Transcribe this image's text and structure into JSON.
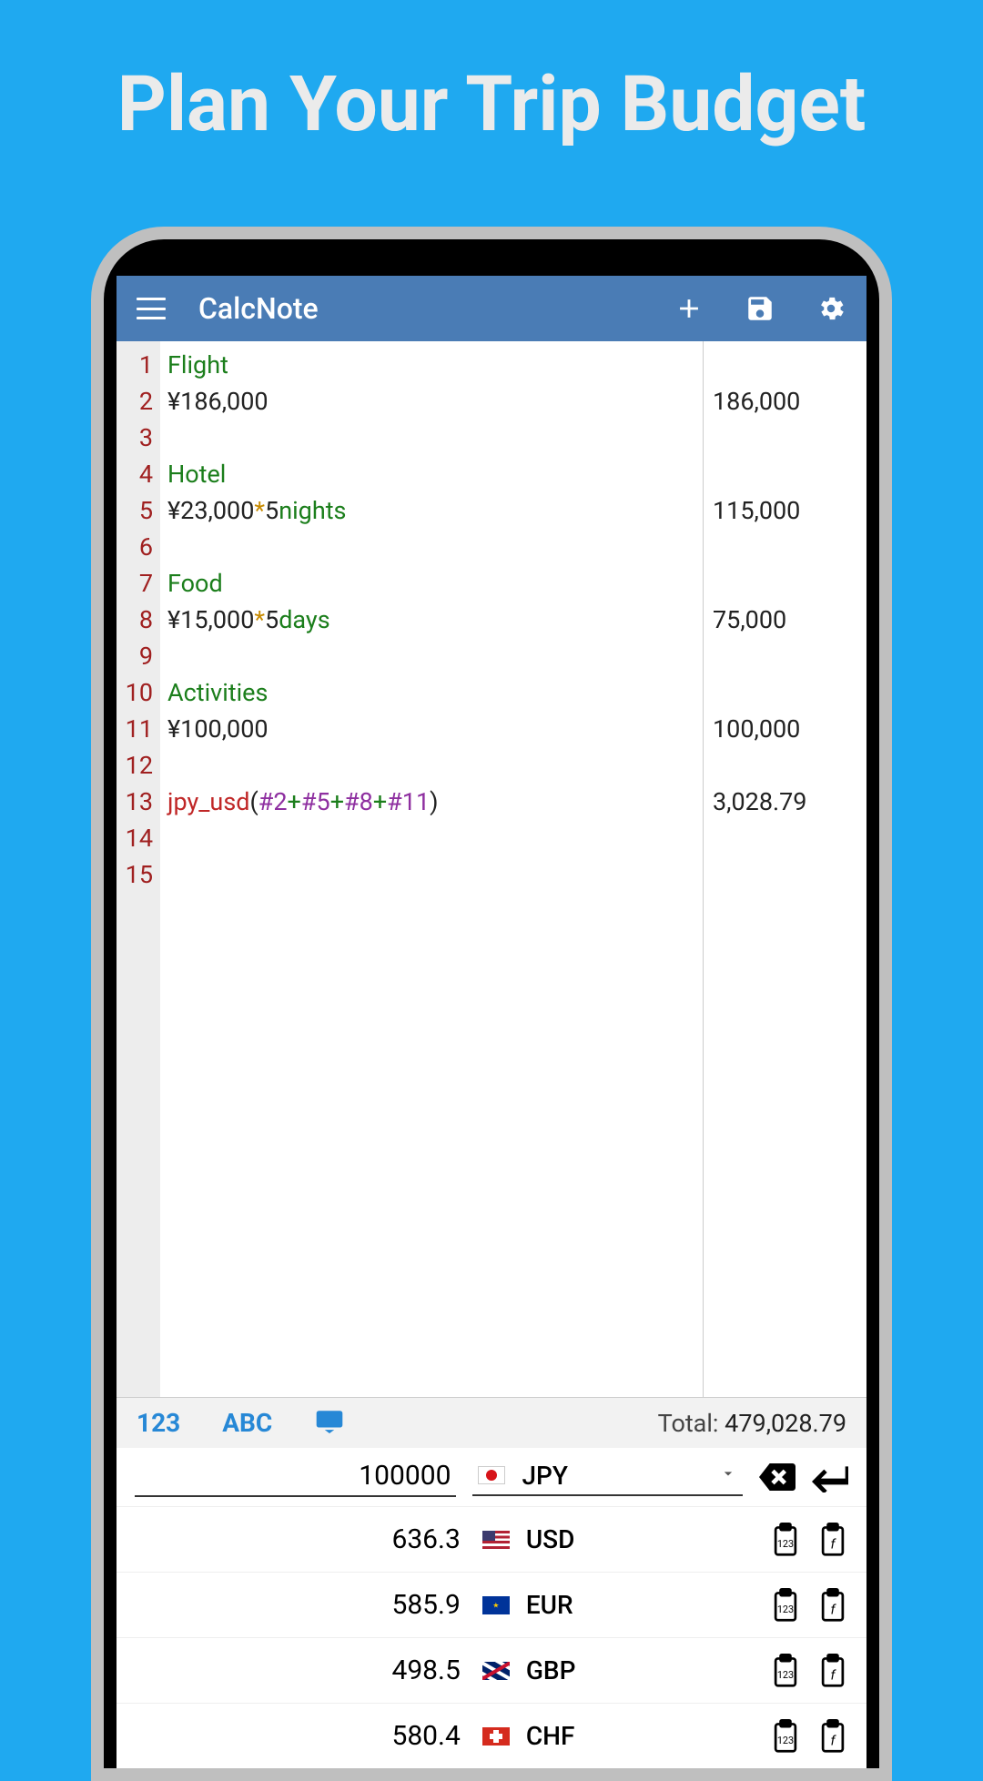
{
  "promo": {
    "title": "Plan Your Trip Budget"
  },
  "appbar": {
    "title": "CalcNote"
  },
  "editor": {
    "lines": [
      {
        "n": 1,
        "parts": [
          {
            "cls": "t-label",
            "t": "Flight"
          }
        ],
        "result": ""
      },
      {
        "n": 2,
        "parts": [
          {
            "cls": "t-plain",
            "t": "¥186,000"
          }
        ],
        "result": "186,000"
      },
      {
        "n": 3,
        "parts": [],
        "result": ""
      },
      {
        "n": 4,
        "parts": [
          {
            "cls": "t-label",
            "t": "Hotel"
          }
        ],
        "result": ""
      },
      {
        "n": 5,
        "parts": [
          {
            "cls": "t-plain",
            "t": "¥23,000 "
          },
          {
            "cls": "t-op",
            "t": "*"
          },
          {
            "cls": "t-plain",
            "t": " 5 "
          },
          {
            "cls": "t-label",
            "t": "nights"
          }
        ],
        "result": "115,000"
      },
      {
        "n": 6,
        "parts": [],
        "result": ""
      },
      {
        "n": 7,
        "parts": [
          {
            "cls": "t-label",
            "t": "Food"
          }
        ],
        "result": ""
      },
      {
        "n": 8,
        "parts": [
          {
            "cls": "t-plain",
            "t": "¥15,000 "
          },
          {
            "cls": "t-op",
            "t": "*"
          },
          {
            "cls": "t-plain",
            "t": " 5 "
          },
          {
            "cls": "t-label",
            "t": "days"
          }
        ],
        "result": "75,000"
      },
      {
        "n": 9,
        "parts": [],
        "result": ""
      },
      {
        "n": 10,
        "parts": [
          {
            "cls": "t-label",
            "t": "Activities"
          }
        ],
        "result": ""
      },
      {
        "n": 11,
        "parts": [
          {
            "cls": "t-plain",
            "t": "¥100,000"
          }
        ],
        "result": "100,000"
      },
      {
        "n": 12,
        "parts": [],
        "result": ""
      },
      {
        "n": 13,
        "parts": [
          {
            "cls": "t-func",
            "t": "jpy_usd"
          },
          {
            "cls": "t-paren",
            "t": "("
          },
          {
            "cls": "t-ref",
            "t": "#2"
          },
          {
            "cls": "t-label",
            "t": " + "
          },
          {
            "cls": "t-ref",
            "t": "#5"
          },
          {
            "cls": "t-label",
            "t": " + "
          },
          {
            "cls": "t-ref",
            "t": "#8"
          },
          {
            "cls": "t-label",
            "t": " + "
          },
          {
            "cls": "t-ref",
            "t": "#11"
          },
          {
            "cls": "t-paren",
            "t": ")"
          }
        ],
        "result": "3,028.79"
      },
      {
        "n": 14,
        "parts": [],
        "result": ""
      },
      {
        "n": 15,
        "parts": [],
        "result": ""
      }
    ]
  },
  "tabs": {
    "num": "123",
    "abc": "ABC"
  },
  "summary": {
    "label": "Total: ",
    "value": "479,028.79"
  },
  "currency": {
    "input_value": "100000",
    "selected_code": "JPY",
    "rows": [
      {
        "value": "636.3",
        "code": "USD",
        "flag": "flag-us"
      },
      {
        "value": "585.9",
        "code": "EUR",
        "flag": "flag-eu"
      },
      {
        "value": "498.5",
        "code": "GBP",
        "flag": "flag-gb"
      },
      {
        "value": "580.4",
        "code": "CHF",
        "flag": "flag-ch"
      }
    ]
  }
}
